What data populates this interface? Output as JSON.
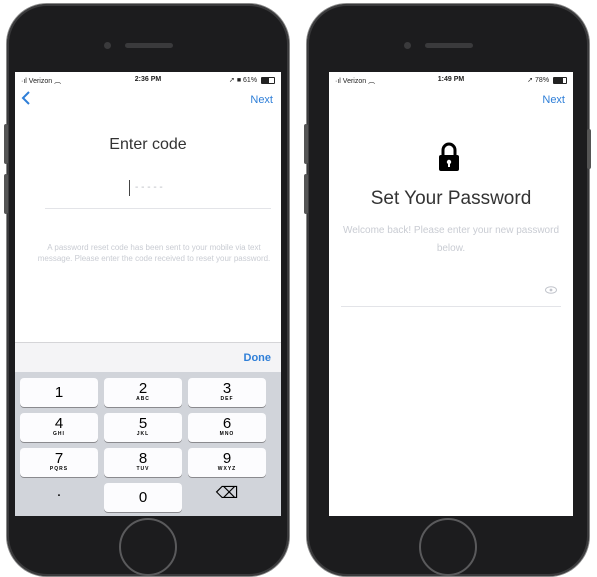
{
  "left_phone": {
    "status": {
      "carrier": "Verizon",
      "time": "2:36 PM",
      "battery": "61%",
      "battery_level": 0.61
    },
    "nav": {
      "next_label": "Next"
    },
    "title": "Enter code",
    "code_placeholder": "- - - - -",
    "help_text": "A password reset code has been sent to your mobile via text message. Please enter the code received to reset your password.",
    "keyboard": {
      "done_label": "Done",
      "keys": [
        {
          "num": "1",
          "letters": ""
        },
        {
          "num": "2",
          "letters": "ABC"
        },
        {
          "num": "3",
          "letters": "DEF"
        },
        {
          "num": "4",
          "letters": "GHI"
        },
        {
          "num": "5",
          "letters": "JKL"
        },
        {
          "num": "6",
          "letters": "MNO"
        },
        {
          "num": "7",
          "letters": "PQRS"
        },
        {
          "num": "8",
          "letters": "TUV"
        },
        {
          "num": "9",
          "letters": "WXYZ"
        },
        {
          "num": ".",
          "letters": ""
        },
        {
          "num": "0",
          "letters": ""
        },
        {
          "num": "⌫",
          "letters": ""
        }
      ]
    }
  },
  "right_phone": {
    "status": {
      "carrier": "Verizon",
      "time": "1:49 PM",
      "battery": "78%",
      "battery_level": 0.78
    },
    "nav": {
      "next_label": "Next"
    },
    "title": "Set Your Password",
    "subtitle": "Welcome back! Please enter your new password below."
  }
}
